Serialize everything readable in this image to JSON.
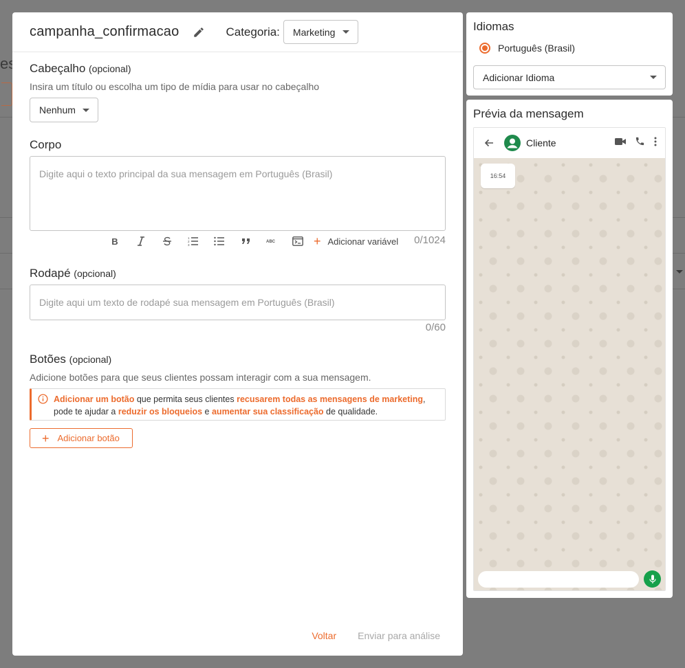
{
  "background": {
    "partial_heading": "es"
  },
  "editor": {
    "template_name": "campanha_confirmacao",
    "category_label": "Categoria:",
    "category_value": "Marketing",
    "header_section": {
      "title": "Cabeçalho",
      "optional": "(opcional)",
      "hint": "Insira um título ou escolha um tipo de mídia para usar no cabeçalho",
      "select_value": "Nenhum"
    },
    "body_section": {
      "title": "Corpo",
      "placeholder": "Digite aqui o texto principal da sua mensagem em Português (Brasil)",
      "add_variable": "Adicionar variável",
      "counter": "0/1024"
    },
    "footer_section": {
      "title": "Rodapé",
      "optional": "(opcional)",
      "placeholder": "Digite aqui um texto de rodapé sua mensagem em Português (Brasil)",
      "counter": "0/60"
    },
    "buttons_section": {
      "title": "Botões",
      "optional": "(opcional)",
      "hint": "Adicione botões para que seus clientes possam interagir com a sua mensagem.",
      "alert": {
        "hl1": "Adicionar um botão",
        "t1": " que permita seus clientes ",
        "hl2": "recusarem todas as mensagens de marketing",
        "t2": ",",
        "t3": "pode te ajudar a ",
        "hl3": "reduzir os bloqueios",
        "t4": " e ",
        "hl4": "aumentar sua classificação",
        "t5": " de qualidade."
      },
      "add_button": "Adicionar botão"
    },
    "actions": {
      "back": "Voltar",
      "submit": "Enviar para análise"
    }
  },
  "languages": {
    "title": "Idiomas",
    "selected": "Português (Brasil)",
    "add_label": "Adicionar Idioma"
  },
  "preview": {
    "title": "Prévia da mensagem",
    "contact": "Cliente",
    "time": "16:54"
  },
  "colors": {
    "accent": "#ec6b2d",
    "whatsapp_green": "#16a04a",
    "contact_icon": "#1f8a4c",
    "chat_bg": "#e7e0d6"
  }
}
